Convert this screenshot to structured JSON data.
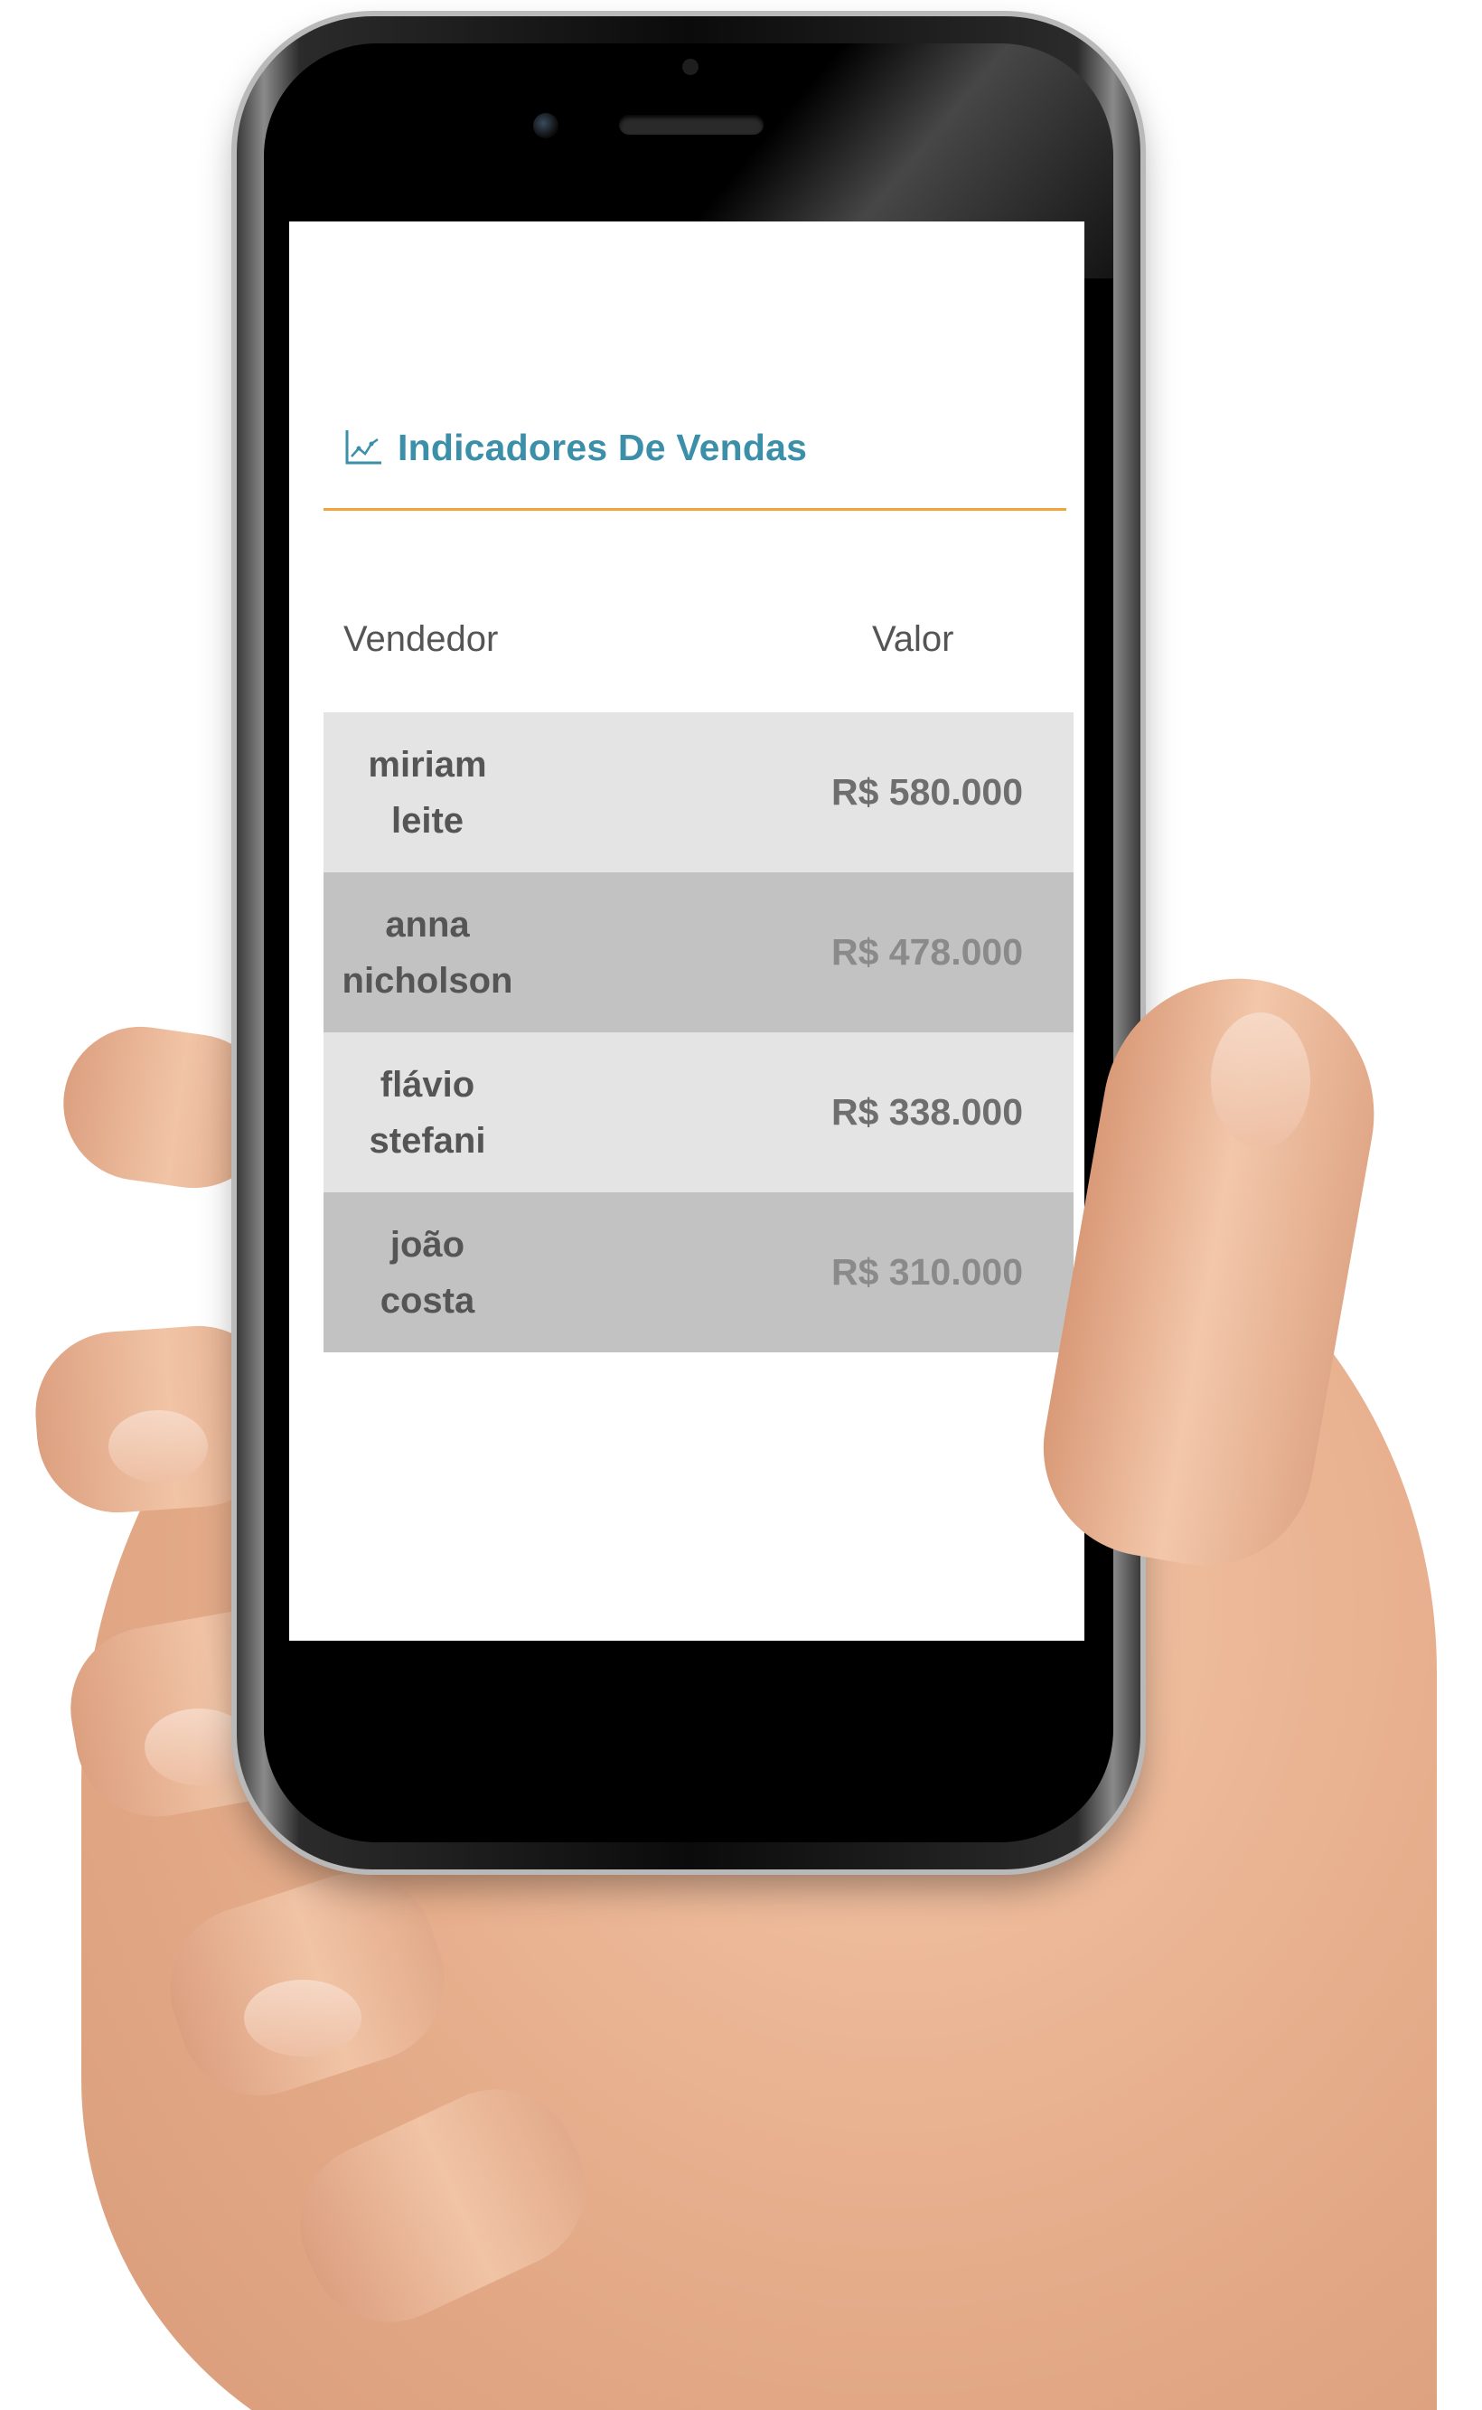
{
  "app": {
    "title": "Indicadores De Vendas",
    "title_icon": "line-chart-icon",
    "accent_color": "#3b8fa8",
    "divider_color": "#f0a43a"
  },
  "table": {
    "headers": {
      "seller": "Vendedor",
      "value": "Valor"
    },
    "rows": [
      {
        "first": "miriam",
        "last": "leite",
        "value": "R$ 580.000"
      },
      {
        "first": "anna",
        "last": "nicholson",
        "value": "R$ 478.000"
      },
      {
        "first": "flávio",
        "last": "stefani",
        "value": "R$ 338.000"
      },
      {
        "first": "joão",
        "last": "costa",
        "value": "R$ 310.000"
      }
    ],
    "row_colors": [
      "#e4e4e4",
      "#c2c2c2"
    ]
  }
}
